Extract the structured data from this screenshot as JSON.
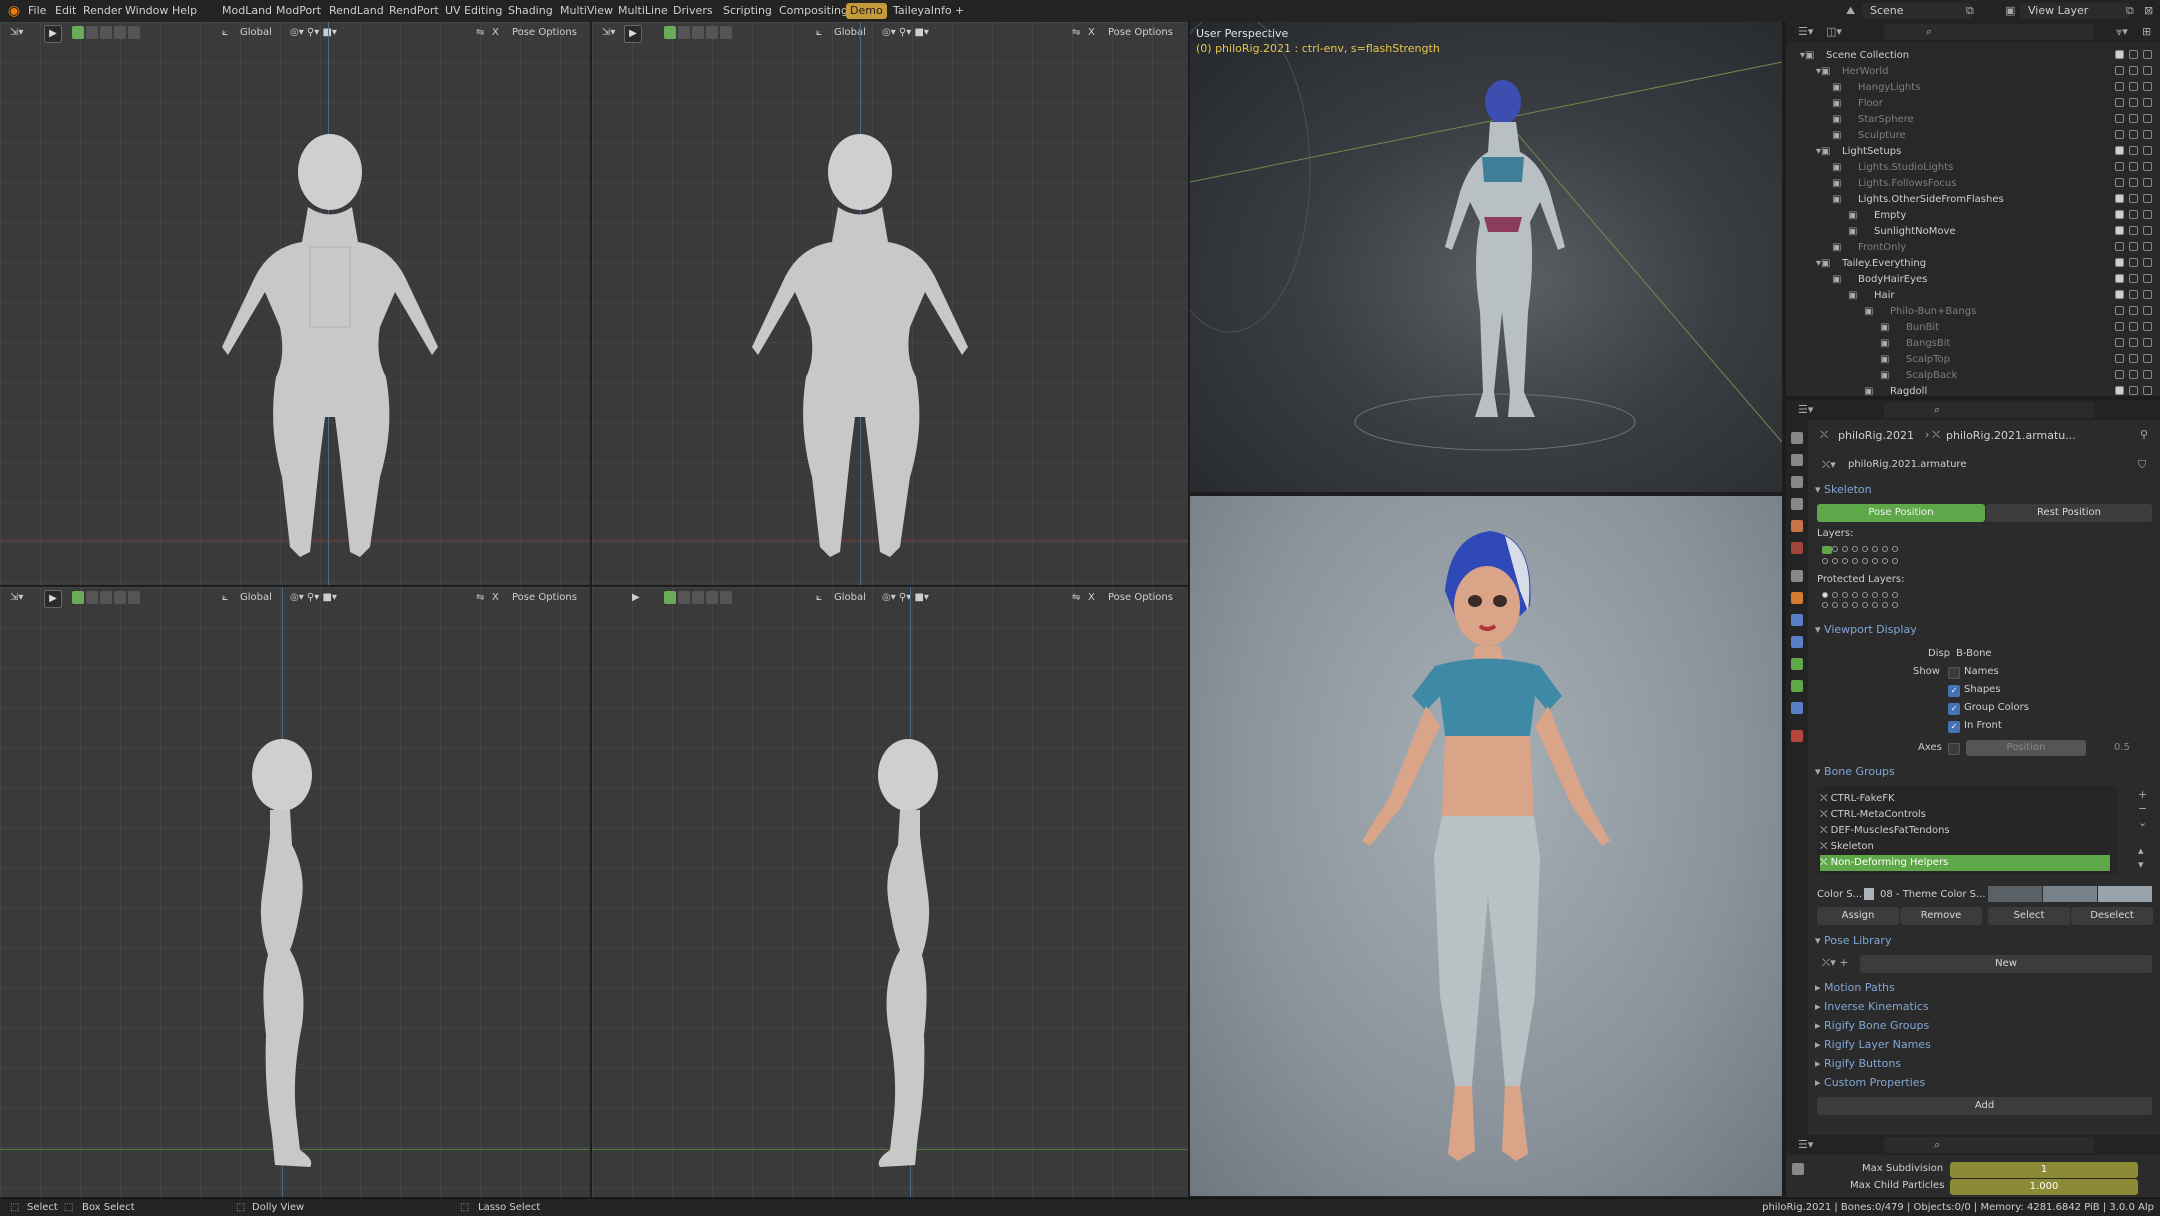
{
  "menu": {
    "items": [
      "File",
      "Edit",
      "Render",
      "Window",
      "Help"
    ],
    "workspaces": [
      "ModLand",
      "ModPort",
      "RendLand",
      "RendPort",
      "UV Editing",
      "Shading",
      "MultiView",
      "MultiLine",
      "Drivers",
      "Scripting",
      "Compositing",
      "Demo",
      "TaileyaInfo",
      "+"
    ],
    "active_workspace": "Demo",
    "scene_label": "Scene",
    "view_layer_label": "View Layer"
  },
  "viewport_header": {
    "transform_orientation": "Global",
    "pose_options": "Pose Options",
    "x_label": "X"
  },
  "viewport_3d": {
    "title": "User Perspective",
    "subtitle": "(0) philoRig.2021 : ctrl-env, s=flashStrength"
  },
  "outliner": {
    "rows": [
      {
        "label": "Scene Collection",
        "indent": 0,
        "dim": false
      },
      {
        "label": "HerWorld",
        "indent": 1,
        "dim": true
      },
      {
        "label": "HangyLights",
        "indent": 2,
        "dim": true
      },
      {
        "label": "Floor",
        "indent": 2,
        "dim": true
      },
      {
        "label": "StarSphere",
        "indent": 2,
        "dim": true
      },
      {
        "label": "Sculpture",
        "indent": 2,
        "dim": true
      },
      {
        "label": "LightSetups",
        "indent": 1,
        "dim": false
      },
      {
        "label": "Lights.StudioLights",
        "indent": 2,
        "dim": true
      },
      {
        "label": "Lights.FollowsFocus",
        "indent": 2,
        "dim": true
      },
      {
        "label": "Lights.OtherSideFromFlashes",
        "indent": 2,
        "dim": false
      },
      {
        "label": "Empty",
        "indent": 3,
        "dim": false
      },
      {
        "label": "SunlightNoMove",
        "indent": 3,
        "dim": false
      },
      {
        "label": "FrontOnly",
        "indent": 2,
        "dim": true
      },
      {
        "label": "Tailey.Everything",
        "indent": 1,
        "dim": false
      },
      {
        "label": "BodyHairEyes",
        "indent": 2,
        "dim": false
      },
      {
        "label": "Hair",
        "indent": 3,
        "dim": false
      },
      {
        "label": "Philo-Bun+Bangs",
        "indent": 4,
        "dim": true
      },
      {
        "label": "BunBit",
        "indent": 5,
        "dim": true
      },
      {
        "label": "BangsBit",
        "indent": 5,
        "dim": true
      },
      {
        "label": "ScalpTop",
        "indent": 5,
        "dim": true
      },
      {
        "label": "ScalpBack",
        "indent": 5,
        "dim": true
      },
      {
        "label": "Ragdoll",
        "indent": 4,
        "dim": false
      }
    ]
  },
  "properties": {
    "object_name": "philoRig.2021",
    "data_name": "philoRig.2021.armatu...",
    "armature_name": "philoRig.2021.armature",
    "skeleton": {
      "heading": "Skeleton",
      "pose_position": "Pose Position",
      "rest_position": "Rest Position",
      "layers_label": "Layers:",
      "protected_layers_label": "Protected Layers:"
    },
    "viewport_display": {
      "heading": "Viewport Display",
      "display_as_label": "Display As",
      "display_as_value": "B-Bone",
      "show_label": "Show",
      "show_names": "Names",
      "show_shapes": "Shapes",
      "show_group_colors": "Group Colors",
      "show_in_front": "In Front",
      "axes_label": "Axes",
      "axes_position": "Position",
      "axes_value": "0.5"
    },
    "bone_groups": {
      "heading": "Bone Groups",
      "items": [
        "CTRL-FakeFK",
        "CTRL-MetaControls",
        "DEF-MusclesFatTendons",
        "Skeleton",
        "Non-Deforming Helpers"
      ],
      "selected": "Non-Deforming Helpers",
      "color_set_label": "Color S...",
      "color_set_value": "08 - Theme Color S...",
      "assign": "Assign",
      "remove": "Remove",
      "select": "Select",
      "deselect": "Deselect"
    },
    "pose_library": {
      "heading": "Pose Library",
      "new_label": "New"
    },
    "collapsed_sections": [
      "Motion Paths",
      "Inverse Kinematics",
      "Rigify Bone Groups",
      "Rigify Layer Names",
      "Rigify Buttons",
      "Custom Properties"
    ],
    "add_label": "Add"
  },
  "bottom_props": {
    "max_subdivision_label": "Max Subdivision",
    "max_subdivision_value": "1",
    "max_child_particles_label": "Max Child Particles",
    "max_child_particles_value": "1.000"
  },
  "statusbar": {
    "select": "Select",
    "box_select": "Box Select",
    "dolly_view": "Dolly View",
    "lasso_select": "Lasso Select",
    "info": "philoRig.2021 | Bones:0/479 | Objects:0/0 | Memory: 4281.6842 PiB | 3.0.0 Alp"
  }
}
